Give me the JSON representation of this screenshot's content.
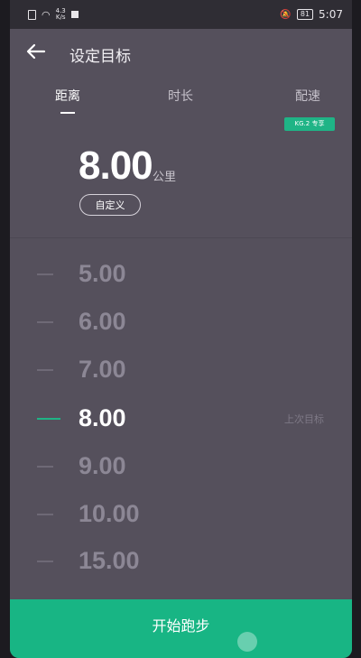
{
  "status_bar": {
    "net_speed_top": "4.3",
    "net_speed_bottom": "K/s",
    "battery": "81",
    "time": "5:07"
  },
  "header": {
    "back_icon": "arrow-left-icon",
    "title": "设定目标"
  },
  "tabs": [
    {
      "label": "距离",
      "active": true
    },
    {
      "label": "时长",
      "active": false
    },
    {
      "label": "配速",
      "active": false
    }
  ],
  "badge": "KG.2 专享",
  "target": {
    "value": "8.00",
    "unit": "公里",
    "custom_label": "自定义"
  },
  "picker": {
    "items": [
      "5.00",
      "6.00",
      "7.00",
      "8.00",
      "9.00",
      "10.00",
      "15.00"
    ],
    "selected": "8.00",
    "last_goal_label": "上次目标"
  },
  "start_button": "开始跑步",
  "colors": {
    "accent": "#18b584",
    "background": "#55505c",
    "status_bar": "#2f2d34"
  }
}
